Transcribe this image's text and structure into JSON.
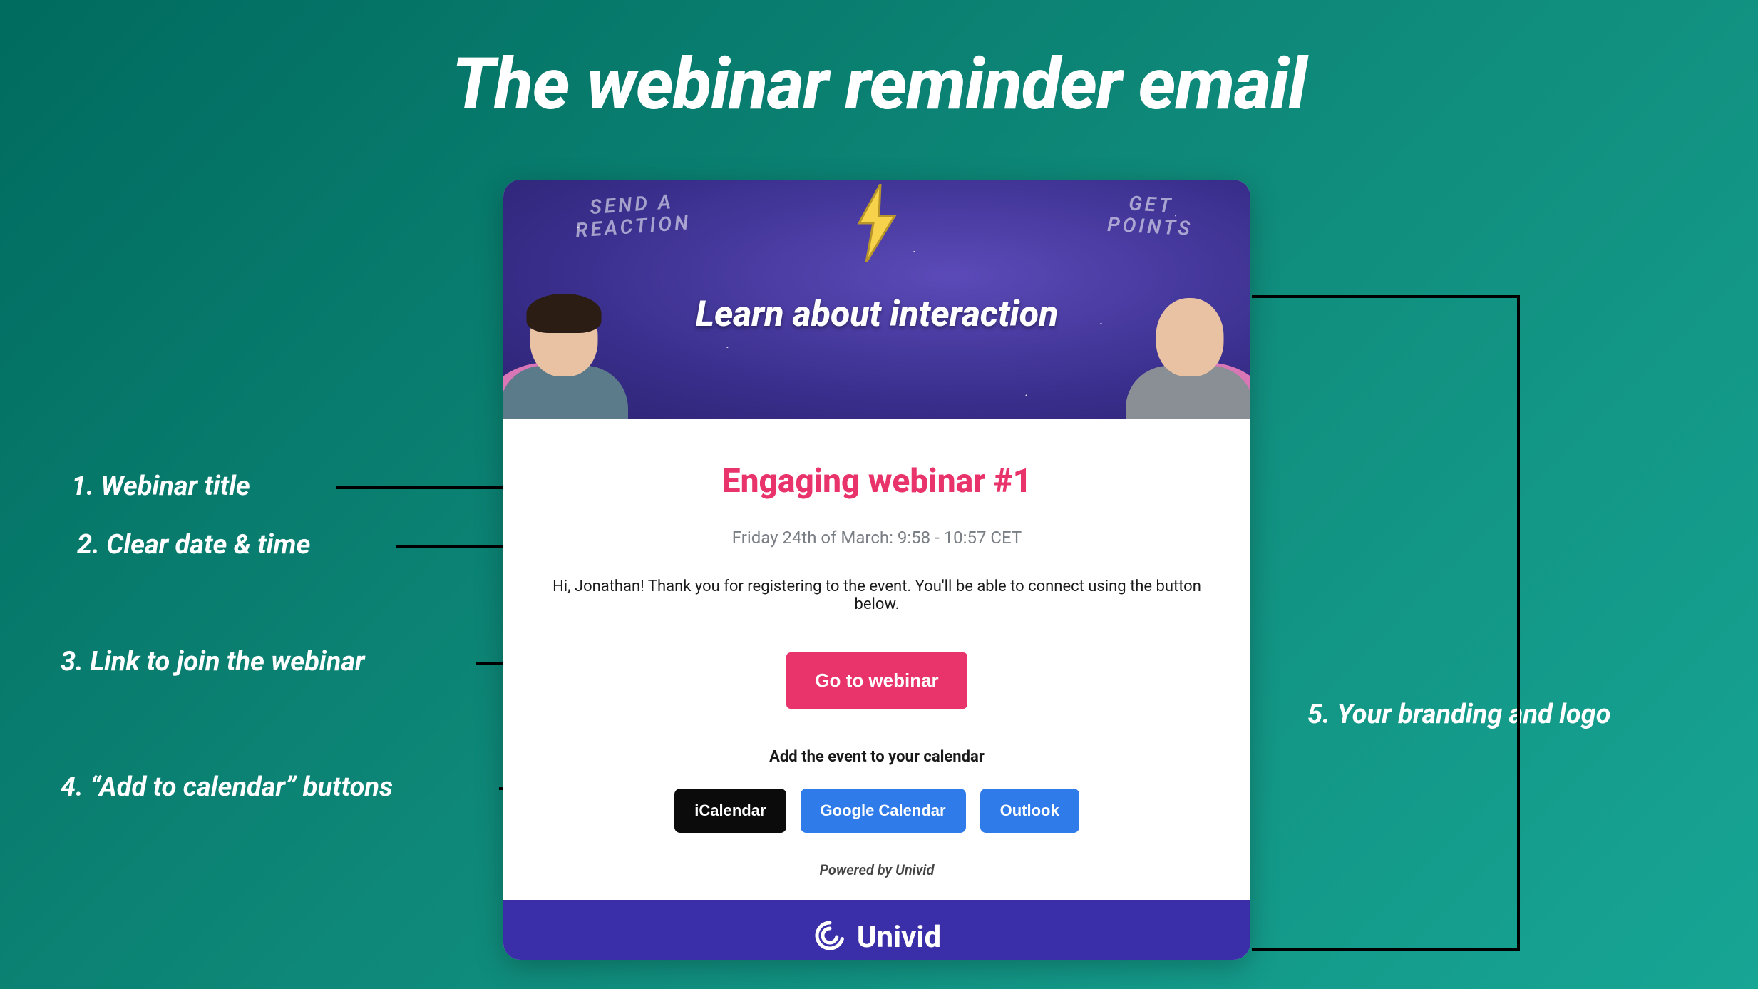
{
  "page": {
    "title": "The webinar reminder email"
  },
  "annotations": {
    "a1": "1. Webinar title",
    "a2": "2. Clear date & time",
    "a3": "3. Link to join the webinar",
    "a4": "4. “Add to calendar” buttons",
    "a5": "5. Your branding and logo"
  },
  "email": {
    "banner": {
      "left_text": "SEND A\nREACTION",
      "right_text": "GET\nPOINTS",
      "title": "Learn about interaction"
    },
    "title": "Engaging webinar #1",
    "datetime": "Friday 24th of March: 9:58 - 10:57 CET",
    "greeting": "Hi, Jonathan! Thank you for registering to the event. You'll be able to connect using the button below.",
    "cta": "Go to webinar",
    "add_calendar_label": "Add the event to your calendar",
    "calendar_buttons": {
      "ical": "iCalendar",
      "google": "Google Calendar",
      "outlook": "Outlook"
    },
    "powered_by": "Powered by Univid",
    "footer_brand": "Univid"
  }
}
